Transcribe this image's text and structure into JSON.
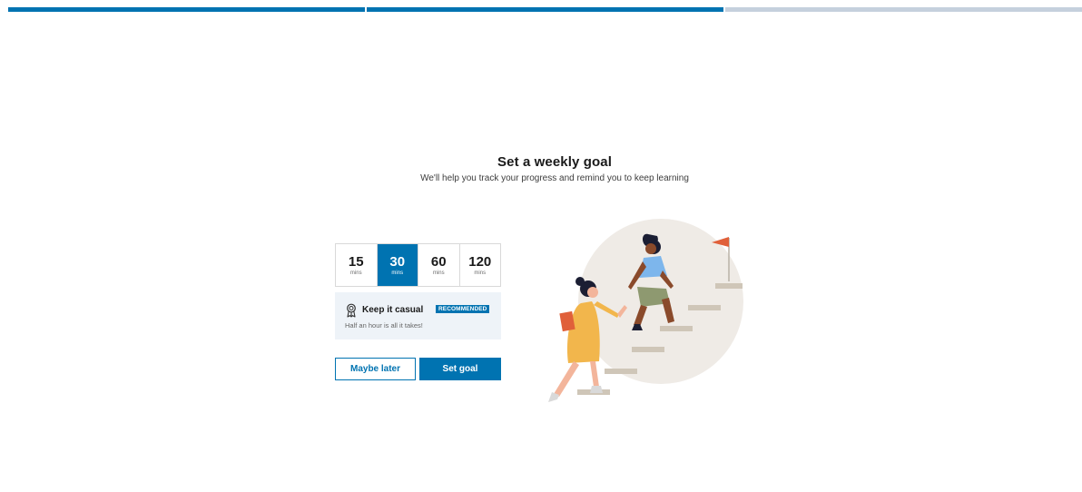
{
  "progress": {
    "total_steps": 3,
    "completed_steps": 2
  },
  "heading": {
    "title": "Set a weekly goal",
    "subtitle": "We'll help you track your progress and remind you to keep learning"
  },
  "goal_options": [
    {
      "value": "15",
      "unit": "mins",
      "selected": false
    },
    {
      "value": "30",
      "unit": "mins",
      "selected": true
    },
    {
      "value": "60",
      "unit": "mins",
      "selected": false
    },
    {
      "value": "120",
      "unit": "mins",
      "selected": false
    }
  ],
  "plan": {
    "icon": "ribbon-award-icon",
    "name": "Keep it casual",
    "badge": "RECOMMENDED",
    "description": "Half an hour is all it takes!"
  },
  "actions": {
    "secondary_label": "Maybe later",
    "primary_label": "Set goal"
  },
  "colors": {
    "accent": "#0073b1",
    "progress_inactive": "#c5d0dd",
    "card_background": "#eef3f8"
  }
}
